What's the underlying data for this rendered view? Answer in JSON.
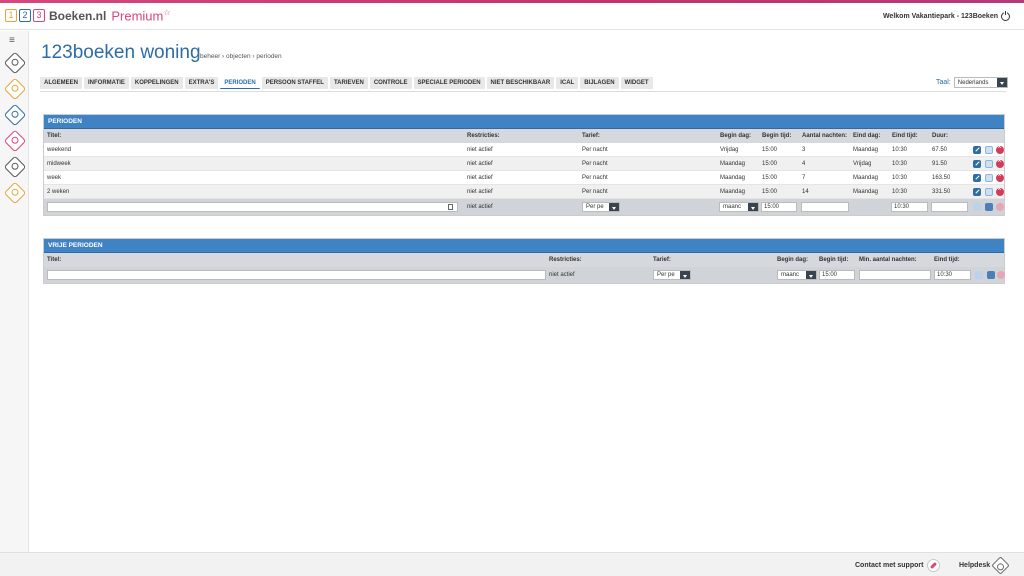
{
  "header": {
    "logo_digits": [
      "1",
      "2",
      "3"
    ],
    "brand": "Boeken.nl",
    "premium": "Premium",
    "premium_star": "☆",
    "welcome": "Welkom Vakantiepark - 123Boeken"
  },
  "sidebar": {
    "menu_icon": "≡",
    "icons": [
      {
        "name": "dashboard-icon",
        "color": "#555555"
      },
      {
        "name": "sun-icon",
        "color": "#e8a33a"
      },
      {
        "name": "transfer-icon",
        "color": "#2d6ca7"
      },
      {
        "name": "percent-icon",
        "color": "#d8467e"
      },
      {
        "name": "ticket-icon",
        "color": "#555555"
      },
      {
        "name": "settings-icon",
        "color": "#e8a33a"
      }
    ]
  },
  "page": {
    "title": "123boeken woning",
    "breadcrumb": "beheer › objecten › perioden"
  },
  "tabs": [
    "ALGEMEEN",
    "INFORMATIE",
    "KOPPELINGEN",
    "EXTRA'S",
    "PERIODEN",
    "PERSOON STAFFEL",
    "TARIEVEN",
    "CONTROLE",
    "SPECIALE PERIODEN",
    "NIET BESCHIKBAAR",
    "ICAL",
    "BIJLAGEN",
    "WIDGET"
  ],
  "active_tab": "PERIODEN",
  "language": {
    "label": "Taal:",
    "value": "Nederlands"
  },
  "perioden": {
    "title": "PERIODEN",
    "columns": {
      "titel": "Titel:",
      "restricties": "Restricties:",
      "tarief": "Tarief:",
      "begin_dag": "Begin dag:",
      "begin_tijd": "Begin tijd:",
      "aantal_nachten": "Aantal nachten:",
      "eind_dag": "Eind dag:",
      "eind_tijd": "Eind tijd:",
      "duur": "Duur:"
    },
    "rows": [
      {
        "titel": "weekend",
        "restricties": "niet actief",
        "tarief": "Per nacht",
        "begin_dag": "Vrijdag",
        "begin_tijd": "15:00",
        "aantal_nachten": "3",
        "eind_dag": "Maandag",
        "eind_tijd": "10:30",
        "duur": "67.50"
      },
      {
        "titel": "midweek",
        "restricties": "niet actief",
        "tarief": "Per nacht",
        "begin_dag": "Maandag",
        "begin_tijd": "15:00",
        "aantal_nachten": "4",
        "eind_dag": "Vrijdag",
        "eind_tijd": "10:30",
        "duur": "91.50"
      },
      {
        "titel": "week",
        "restricties": "niet actief",
        "tarief": "Per nacht",
        "begin_dag": "Maandag",
        "begin_tijd": "15:00",
        "aantal_nachten": "7",
        "eind_dag": "Maandag",
        "eind_tijd": "10:30",
        "duur": "163.50"
      },
      {
        "titel": "2 weken",
        "restricties": "niet actief",
        "tarief": "Per nacht",
        "begin_dag": "Maandag",
        "begin_tijd": "15:00",
        "aantal_nachten": "14",
        "eind_dag": "Maandag",
        "eind_tijd": "10:30",
        "duur": "331.50"
      }
    ],
    "new_row": {
      "titel": "",
      "restricties": "niet actief",
      "tarief": "Per pe",
      "begin_dag": "maanc",
      "begin_tijd": "15:00",
      "aantal_nachten": "",
      "eind_tijd": "10:30",
      "duur": ""
    }
  },
  "vrije_perioden": {
    "title": "VRIJE PERIODEN",
    "columns": {
      "titel": "Titel:",
      "restricties": "Restricties:",
      "tarief": "Tarief:",
      "begin_dag": "Begin dag:",
      "begin_tijd": "Begin tijd:",
      "min_aantal_nachten": "Min. aantal nachten:",
      "eind_tijd": "Eind tijd:"
    },
    "new_row": {
      "titel": "",
      "restricties": "niet actief",
      "tarief": "Per pe",
      "begin_dag": "maanc",
      "begin_tijd": "15:00",
      "min_aantal_nachten": "",
      "eind_tijd": "10:30"
    }
  },
  "footer": {
    "support": "Contact met support",
    "helpdesk": "Helpdesk"
  }
}
